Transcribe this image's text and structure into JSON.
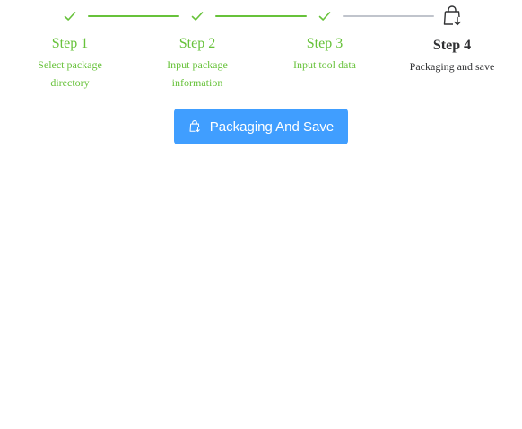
{
  "steps": [
    {
      "title": "Step 1",
      "description": "Select package directory",
      "status": "finished",
      "icon": "check-icon"
    },
    {
      "title": "Step 2",
      "description": "Input package information",
      "status": "finished",
      "icon": "check-icon"
    },
    {
      "title": "Step 3",
      "description": "Input tool data",
      "status": "finished",
      "icon": "check-icon"
    },
    {
      "title": "Step 4",
      "description": "Packaging and save",
      "status": "active",
      "icon": "shopping-bag-download-icon"
    }
  ],
  "save_button": {
    "label": "Packaging And Save",
    "icon": "shopping-bag-download-icon"
  },
  "colors": {
    "finished": "#67c23a",
    "pending_line": "#c0c4cc",
    "active_text": "#303133",
    "primary": "#409eff"
  }
}
